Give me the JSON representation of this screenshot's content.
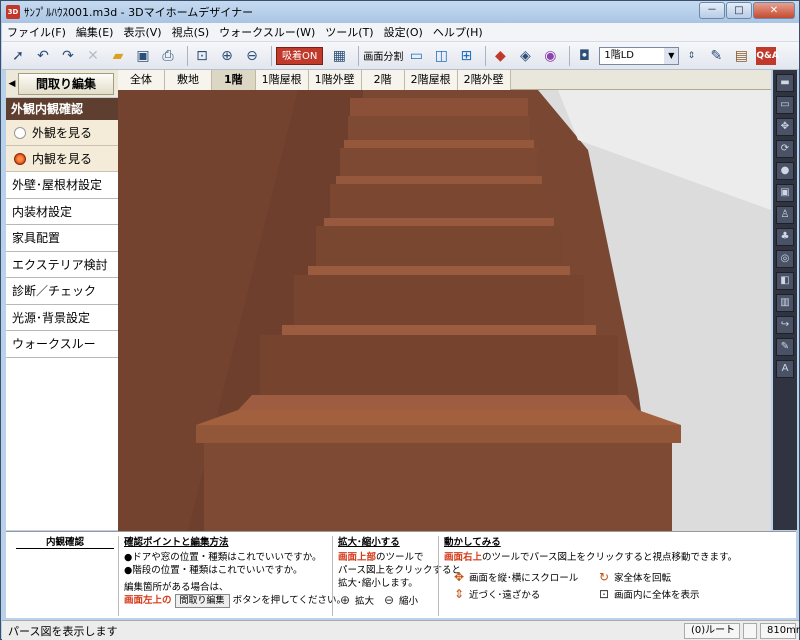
{
  "window": {
    "title": "ｻﾝﾌﾟﾙﾊｳｽ001.m3d - 3Dマイホームデザイナー",
    "app_icon": "app-logo-icon",
    "minimize": "－",
    "maximize": "□",
    "close": "✕"
  },
  "menu": [
    {
      "label": "ファイル(F)"
    },
    {
      "label": "編集(E)"
    },
    {
      "label": "表示(V)"
    },
    {
      "label": "視点(S)"
    },
    {
      "label": "ウォークスルー(W)"
    },
    {
      "label": "ツール(T)"
    },
    {
      "label": "設定(O)"
    },
    {
      "label": "ヘルプ(H)"
    }
  ],
  "toolbar": {
    "snap_label": "吸着ON",
    "split_label": "画面分割",
    "floor_value": "1階LD",
    "qa_label": "Q&A"
  },
  "left_panel": {
    "madori_button": "間取り編集",
    "section_title": "外観内観確認",
    "view_options": [
      {
        "label": "外観を見る",
        "selected": false
      },
      {
        "label": "内観を見る",
        "selected": true
      }
    ],
    "nav_items": [
      {
        "label": "外壁･屋根材設定"
      },
      {
        "label": "内装材設定"
      },
      {
        "label": "家具配置"
      },
      {
        "label": "エクステリア検討"
      },
      {
        "label": "診断／チェック"
      },
      {
        "label": "光源･背景設定"
      },
      {
        "label": "ウォークスルー"
      }
    ]
  },
  "tabs": [
    {
      "label": "全体",
      "active": false
    },
    {
      "label": "敷地",
      "active": false
    },
    {
      "label": "1階",
      "active": true
    },
    {
      "label": "1階屋根",
      "active": false
    },
    {
      "label": "1階外壁",
      "active": false
    },
    {
      "label": "2階",
      "active": false
    },
    {
      "label": "2階屋根",
      "active": false
    },
    {
      "label": "2階外壁",
      "active": false
    }
  ],
  "bottom": {
    "left_title": "内観確認",
    "points": {
      "title": "確認ポイントと編集方法",
      "line1": "●ドアや窓の位置・種類はこれでいいですか。",
      "line2": "●階段の位置・種類はこれでいいですか。",
      "line3": "編集箇所がある場合は、",
      "line4_red": "画面左上の",
      "line4_button": "間取り編集",
      "line4_rest": "ボタンを押してください。"
    },
    "zoom": {
      "title": "拡大･縮小する",
      "line1_red": "画面上部",
      "line1_rest": "のツールで",
      "line2": "パース図上をクリックすると",
      "line3": "拡大･縮小します。",
      "zoom_in": "拡大",
      "zoom_out": "縮小"
    },
    "move": {
      "title": "動かしてみる",
      "line1_red": "画面右上",
      "line1_rest": "のツールでパース図上をクリックすると視点移動できます。",
      "op1": "画面を縦･横にスクロール",
      "op2": "家全体を回転",
      "op3": "近づく･遠ざかる",
      "op4": "画面内に全体を表示"
    }
  },
  "status": {
    "text": "パース図を表示します",
    "route": "(0)ルート",
    "size": "810mm"
  }
}
